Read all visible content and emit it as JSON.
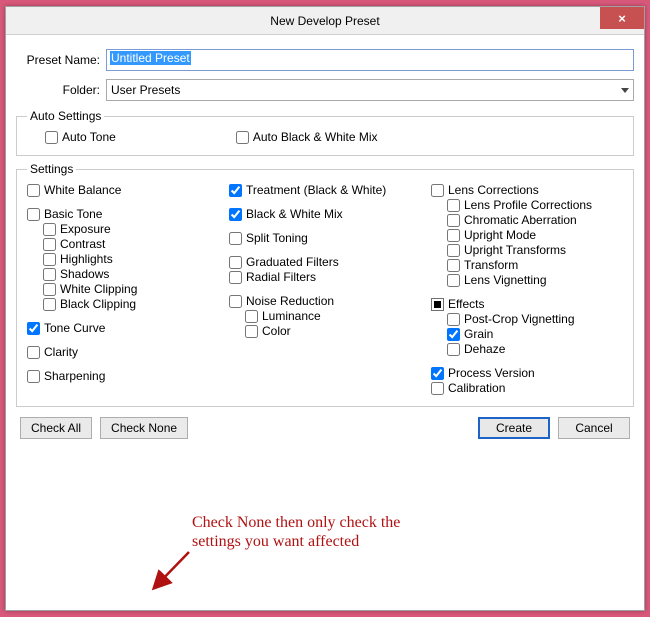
{
  "window": {
    "title": "New Develop Preset",
    "close_label": "×"
  },
  "form": {
    "preset_name_label": "Preset Name:",
    "preset_name_value": "Untitled Preset",
    "folder_label": "Folder:",
    "folder_value": "User Presets"
  },
  "auto": {
    "legend": "Auto Settings",
    "auto_tone": "Auto Tone",
    "auto_bw_mix": "Auto Black & White Mix"
  },
  "settings": {
    "legend": "Settings",
    "col1": {
      "white_balance": "White Balance",
      "basic_tone": "Basic Tone",
      "exposure": "Exposure",
      "contrast": "Contrast",
      "highlights": "Highlights",
      "shadows": "Shadows",
      "white_clipping": "White Clipping",
      "black_clipping": "Black Clipping",
      "tone_curve": "Tone Curve",
      "clarity": "Clarity",
      "sharpening": "Sharpening"
    },
    "col2": {
      "treatment": "Treatment (Black & White)",
      "bw_mix": "Black & White Mix",
      "split_toning": "Split Toning",
      "grad_filters": "Graduated Filters",
      "radial_filters": "Radial Filters",
      "noise_reduction": "Noise Reduction",
      "luminance": "Luminance",
      "color": "Color"
    },
    "col3": {
      "lens_corrections": "Lens Corrections",
      "lens_profile": "Lens Profile Corrections",
      "chromatic_ab": "Chromatic Aberration",
      "upright_mode": "Upright Mode",
      "upright_transforms": "Upright Transforms",
      "transform": "Transform",
      "lens_vignetting": "Lens Vignetting",
      "effects": "Effects",
      "post_crop_vig": "Post-Crop Vignetting",
      "grain": "Grain",
      "dehaze": "Dehaze",
      "process_version": "Process Version",
      "calibration": "Calibration"
    }
  },
  "buttons": {
    "check_all": "Check All",
    "check_none": "Check None",
    "create": "Create",
    "cancel": "Cancel"
  },
  "annotation": {
    "line1": "Check None then only check the",
    "line2": "settings you want affected"
  }
}
